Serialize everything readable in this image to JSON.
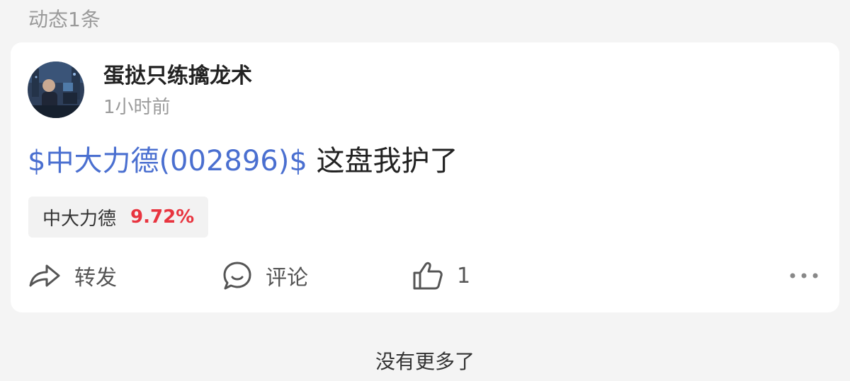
{
  "header": {
    "count_text": "动态1条"
  },
  "post": {
    "username": "蛋挞只练擒龙术",
    "timestamp": "1小时前",
    "stock_link": "$中大力德(002896)$",
    "body_text": " 这盘我护了",
    "stock_chip": {
      "name": "中大力德",
      "change": "9.72%"
    },
    "actions": {
      "repost_label": "转发",
      "comment_label": "评论",
      "like_count": "1"
    }
  },
  "footer": {
    "no_more_text": "没有更多了"
  },
  "colors": {
    "stock_link": "#4a6fd0",
    "price_up": "#e8343f",
    "card_bg": "#ffffff",
    "page_bg": "#f4f4f4"
  },
  "icons": {
    "repost": "share-arrow-icon",
    "comment": "speech-bubble-icon",
    "like": "thumbs-up-icon",
    "more": "more-dots-icon"
  }
}
